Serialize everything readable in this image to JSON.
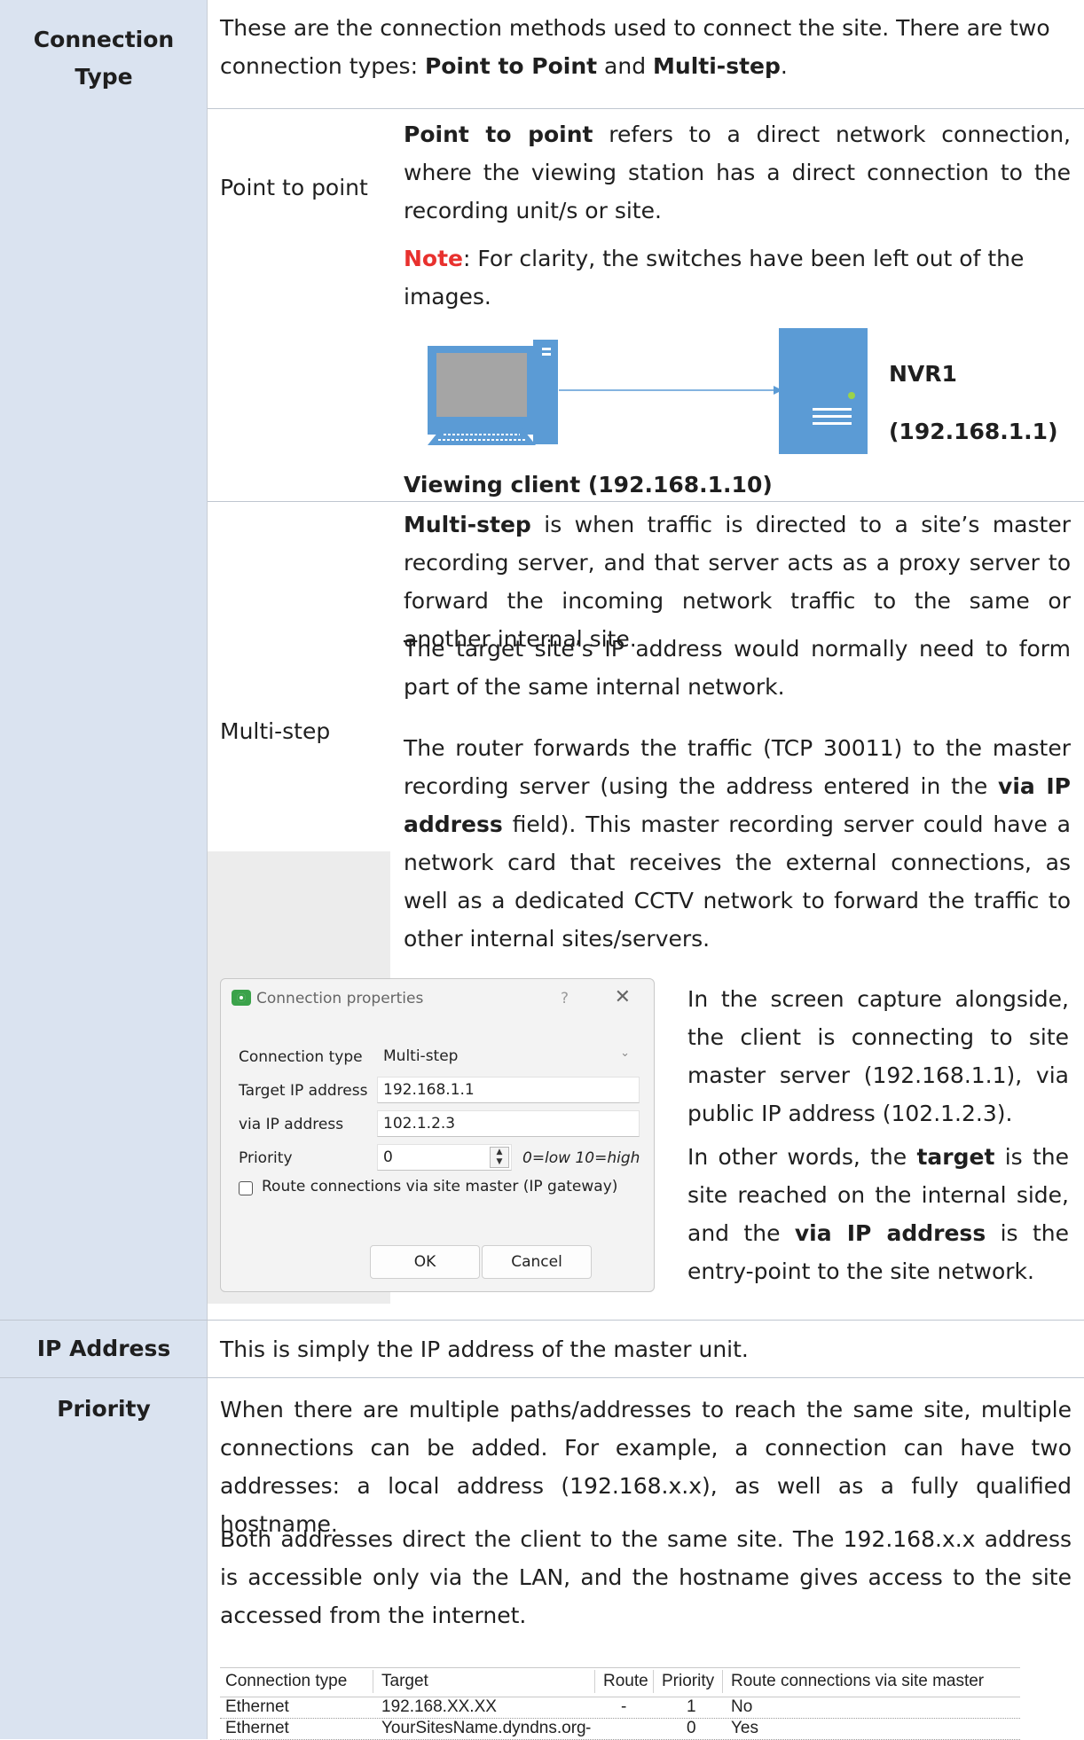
{
  "rows": {
    "connection_type": {
      "label_line1": "Connection",
      "label_line2": "Type",
      "intro_a": "These are the connection methods used to connect the site. There are two",
      "intro_b": "connection types: ",
      "intro_bold1": "Point to Point",
      "intro_and": " and ",
      "intro_bold2": "Multi-step",
      "intro_end": "."
    },
    "point_to_point": {
      "label": "Point to point",
      "p1_bold": "Point to point",
      "p1_rest": " refers to a direct network connection, where the viewing station has a direct connection to the recording unit/s or site.",
      "note_label": "Note",
      "note_text": ": For clarity, the switches have been left out of the images.",
      "nvr_name": "NVR1",
      "nvr_ip": "(192.168.1.1)",
      "client_caption": "Viewing client (192.168.1.10)"
    },
    "multi_step": {
      "label": "Multi-step",
      "p1_bold": "Multi-step",
      "p1_rest": " is when traffic is directed to a site’s master recording server, and that server acts as a proxy server to forward the incoming network traffic to the same or another internal site.",
      "p2": "The target site’s IP address would normally need to form part of the same internal network.",
      "p3_a": "The router forwards the traffic (TCP 30011) to the master recording server (using the address entered in the ",
      "p3_bold": "via IP address",
      "p3_b": " field). This master recording server could have a network card that receives the external connections, as well as a dedicated CCTV network to forward the traffic to other internal sites/servers.",
      "side_p1": "In the screen capture alongside, the client is connecting to site master server (192.168.1.1), via public IP address (102.1.2.3).",
      "side_p2_a": "In other words, the ",
      "side_p2_bold1": "target",
      "side_p2_b": " is the site reached on the internal side, and the ",
      "side_p2_bold2": "via IP address",
      "side_p2_c": " is the entry-point to the site network."
    },
    "ip_address": {
      "label": "IP Address",
      "text": "This is simply the IP address of the master unit."
    },
    "priority": {
      "label": "Priority",
      "p1": "When there are multiple paths/addresses to reach the same site, multiple connections can be added. For example, a connection can have two addresses: a local address (192.168.x.x), as well as a fully qualified hostname.",
      "p2": "Both addresses direct the client to the same site. The 192.168.x.x address is accessible only via the LAN, and the hostname gives access to the site accessed from the internet."
    }
  },
  "dialog": {
    "title": "Connection properties",
    "help": "?",
    "close": "✕",
    "connection_type_label": "Connection type",
    "connection_type_value": "Multi-step",
    "target_ip_label": "Target IP address",
    "target_ip_value": "192.168.1.1",
    "via_ip_label": "via IP address",
    "via_ip_value": "102.1.2.3",
    "priority_label": "Priority",
    "priority_value": "0",
    "priority_hint": "0=low 10=high",
    "route_label": "Route connections via site master (IP gateway)",
    "route_checked": false,
    "ok": "OK",
    "cancel": "Cancel"
  },
  "connections_table": {
    "headers": [
      "Connection type",
      "Target",
      "Route",
      "Priority",
      "Route connections via site master"
    ],
    "rows": [
      [
        "Ethernet",
        "192.168.XX.XX",
        "-",
        "1",
        "No"
      ],
      [
        "Ethernet",
        "YourSitesName.dyndns.org",
        "-",
        "0",
        "Yes"
      ]
    ]
  }
}
